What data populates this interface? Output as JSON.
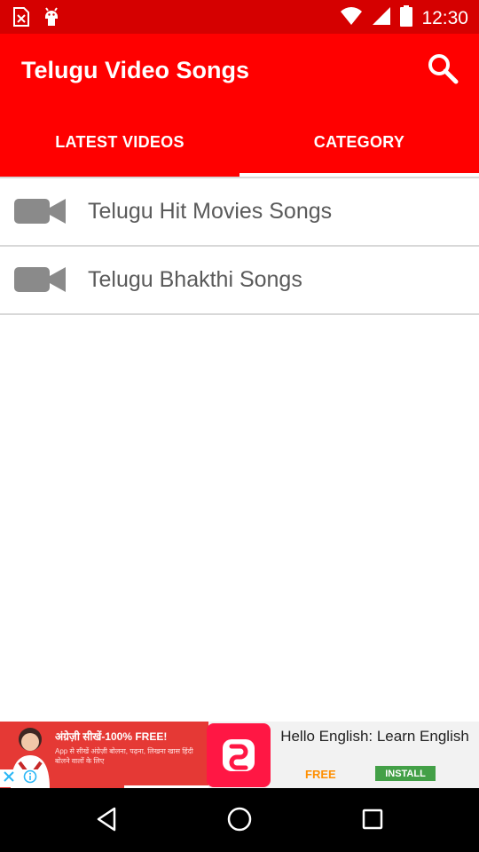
{
  "status_bar": {
    "time": "12:30",
    "icons": [
      "sim-error-icon",
      "android-debug-icon",
      "wifi-icon",
      "signal-icon",
      "battery-icon"
    ]
  },
  "app_bar": {
    "title": "Telugu Video Songs",
    "search_icon": "search-icon"
  },
  "tabs": [
    {
      "label": "LATEST VIDEOS",
      "selected": false
    },
    {
      "label": "CATEGORY",
      "selected": true
    }
  ],
  "list": {
    "items": [
      {
        "label": "Telugu Hit Movies Songs",
        "icon": "video-camera-icon"
      },
      {
        "label": "Telugu Bhakthi Songs",
        "icon": "video-camera-icon"
      }
    ]
  },
  "ad": {
    "left_headline": "अंग्रेज़ी सीखें-100% FREE!",
    "left_subtext": "App से सीखें अंग्रेज़ी बोलना, पढ़ना, लिखना खास हिंदी बोलने वालों के लिए",
    "title": "Hello English: Learn English",
    "free_label": "FREE",
    "install_label": "INSTALL"
  },
  "nav_bar": {
    "back": "back-icon",
    "home": "home-icon",
    "recents": "recents-icon"
  },
  "colors": {
    "primary": "#ff0000",
    "status_bar": "#d50000",
    "divider": "#d8d8d8",
    "list_text": "#5a5a5a",
    "icon_gray": "#8a8a8a"
  }
}
